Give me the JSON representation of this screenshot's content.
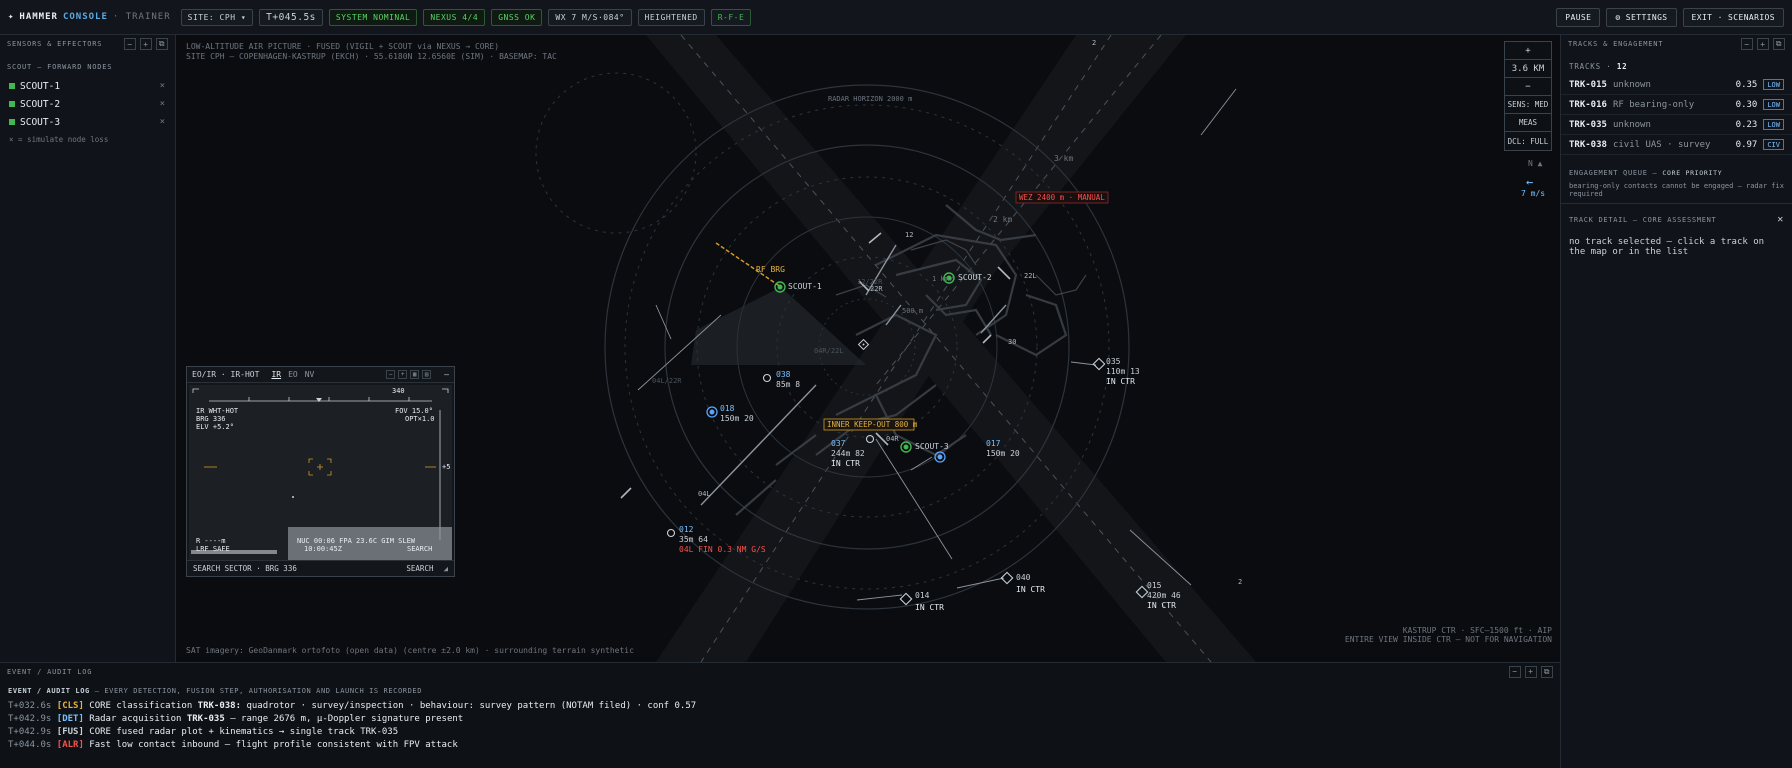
{
  "topbar": {
    "brand_name": "HAMMER",
    "brand_accent": "CONSOLE",
    "brand_sub": "· TRAINER",
    "chips": [
      {
        "label": "SITE: CPH ▾",
        "style": "normal"
      },
      {
        "label": "T+045.5s",
        "style": "big"
      },
      {
        "label": "SYSTEM NOMINAL",
        "style": "green"
      },
      {
        "label": "NEXUS 4/4",
        "style": "green"
      },
      {
        "label": "GNSS OK",
        "style": "green"
      },
      {
        "label": "WX 7 M/S·084°",
        "style": "normal"
      },
      {
        "label": "HEIGHTENED",
        "style": "normal"
      },
      {
        "label": "R-F-E",
        "style": "teal"
      }
    ],
    "buttons": {
      "pause": "PAUSE",
      "settings": "⚙ SETTINGS",
      "exit": "EXIT · SCENARIOS"
    }
  },
  "left_panel": {
    "title": "SENSORS & EFFECTORS",
    "section": "SCOUT — FORWARD NODES",
    "nodes": [
      "SCOUT-1",
      "SCOUT-2",
      "SCOUT-3"
    ],
    "node_remove": "×",
    "hint": "× = simulate node loss"
  },
  "map": {
    "header_line1": "LOW-ALTITUDE AIR PICTURE · FUSED (VIGIL + SCOUT via NEXUS → CORE)",
    "header_line2": "SITE CPH — COPENHAGEN-KASTRUP (EKCH) · 55.6180N 12.6560E (SIM) · BASEMAP: TAC",
    "radar_horizon": "RADAR HORIZON 2000 m",
    "ring_3km": "3 km",
    "ring_2km": "2 km",
    "ring_1km": "1 km",
    "ring_500m": "500 m",
    "wez": "WEZ 2400 m · MANUAL",
    "keepout": "INNER KEEP-OUT 800 m",
    "rf_brg": "RF BRG",
    "runway_labels": {
      "r12": "12",
      "r22r": "22R",
      "r22l": "22L",
      "r30": "30",
      "r04r": "04R",
      "r04l": "04L",
      "r2a": "2",
      "r2b": "2",
      "r12_22r": "12/22R",
      "r04r22l": "04R/22L",
      "r04l22r": "04L/22R"
    },
    "scouts": [
      {
        "label": "SCOUT-1"
      },
      {
        "label": "SCOUT-2"
      },
      {
        "label": "SCOUT-3"
      }
    ],
    "tracks": [
      {
        "id": "035",
        "l2": "110m 13",
        "l3": "IN CTR",
        "kind": "diamond"
      },
      {
        "id": "038",
        "l2": "85m 8",
        "l3": "",
        "kind": "circle-small"
      },
      {
        "id": "018",
        "l2": "150m 20",
        "l3": "",
        "kind": "circle-blue"
      },
      {
        "id": "037",
        "l2": "244m 82",
        "l3": "IN CTR",
        "kind": "circle-small"
      },
      {
        "id": "017",
        "l2": "150m 20",
        "l3": "",
        "kind": "circle-blue"
      },
      {
        "id": "012",
        "l2": "35m 64",
        "l3": "04L FIN 0.3 NM G/S",
        "kind": "circle-small"
      },
      {
        "id": "014",
        "l2": "",
        "l3": "IN CTR",
        "kind": "diamond"
      },
      {
        "id": "040",
        "l2": "",
        "l3": "IN CTR",
        "kind": "diamond"
      },
      {
        "id": "015",
        "l2": "420m 46",
        "l3": "IN CTR",
        "kind": "diamond"
      }
    ],
    "tools": {
      "zoom_in": "+",
      "scale": "3.6 KM",
      "zoom_out": "−",
      "sens": "SENS: MED",
      "meas": "MEAS",
      "dcl": "DCL: FULL"
    },
    "north": "N ▲",
    "wind_arrow": "←",
    "wind_speed": "7 m/s",
    "footer_left": "SAT imagery: GeoDanmark ortofoto (open data) (centre ±2.0 km) · surrounding terrain synthetic",
    "footer_right1": "KASTRUP CTR · SFC–1500 ft · AIP",
    "footer_right2": "ENTIRE VIEW INSIDE CTR — NOT FOR NAVIGATION"
  },
  "eoir": {
    "title": "EO/IR · IR-HOT",
    "modes": [
      "IR",
      "EO",
      "NV"
    ],
    "active_mode": "IR",
    "ctrl_minus": "−",
    "ctrl_plus": "+",
    "ctrl_grid": "▦",
    "ctrl_rec": "▤",
    "ctrl_close": "—",
    "tl1": "IR   WHT-HOT",
    "tl2": "BRG 336",
    "tl3": "ELV +5.2°",
    "tr1": "FOV 15.0°",
    "tr2": "OPT×1.0",
    "heading": "340",
    "elev_scale": "+5",
    "bl1": "R ----m",
    "bl2": "LRF SAFE",
    "nuc": "NUC 00:06  FPA 23.6C  GIM SLEW",
    "clock": "10:00:45Z",
    "search_tag": "SEARCH",
    "footer_left": "SEARCH SECTOR · BRG 336",
    "footer_right": "SEARCH"
  },
  "right_panel": {
    "title": "TRACKS & ENGAGEMENT",
    "tracks_label": "TRACKS ·",
    "tracks_count": "12",
    "tracks": [
      {
        "id": "TRK-015",
        "cls": "unknown",
        "conf": "0.35",
        "badge": "LOW"
      },
      {
        "id": "TRK-016",
        "cls": "RF bearing-only",
        "conf": "0.30",
        "badge": "LOW"
      },
      {
        "id": "TRK-035",
        "cls": "unknown",
        "conf": "0.23",
        "badge": "LOW"
      },
      {
        "id": "TRK-038",
        "cls": "civil UAS · survey",
        "conf": "0.97",
        "badge": "CIV"
      }
    ],
    "eq_title": "ENGAGEMENT QUEUE —",
    "eq_sub": "CORE PRIORITY",
    "eq_note": "bearing-only contacts cannot be engaged — radar fix required",
    "td_title": "TRACK DETAIL — CORE ASSESSMENT",
    "td_close": "✕",
    "td_body": "no track selected — click a track on the map or in the list"
  },
  "bottom": {
    "title": "EVENT / AUDIT LOG",
    "sub_strong": "EVENT / AUDIT LOG",
    "sub_rest": "— EVERY DETECTION, FUSION STEP, AUTHORISATION AND LAUNCH IS RECORDED",
    "lines": [
      {
        "t": "T+032.6s",
        "tag": "[CLS]",
        "tagc": "CLS",
        "pre": "CORE classification ",
        "strong": "TRK-038:",
        "post": " quadrotor · survey/inspection · behaviour: survey pattern (NOTAM filed) · conf 0.57"
      },
      {
        "t": "T+042.9s",
        "tag": "[DET]",
        "tagc": "DET",
        "pre": "Radar acquisition ",
        "strong": "TRK-035",
        "post": " — range 2676 m, µ-Doppler signature present"
      },
      {
        "t": "T+042.9s",
        "tag": "[FUS]",
        "tagc": "FUS",
        "pre": "CORE fused radar plot + kinematics → single track TRK-035",
        "strong": "",
        "post": ""
      },
      {
        "t": "T+044.0s",
        "tag": "[ALR]",
        "tagc": "ALR",
        "pre": "Fast low contact inbound — flight profile consistent with FPV attack",
        "strong": "",
        "post": ""
      }
    ]
  }
}
